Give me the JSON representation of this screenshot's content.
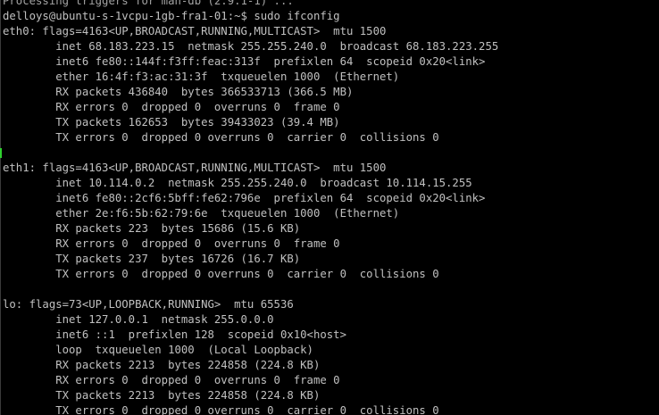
{
  "terminal": {
    "lines": [
      "Processing triggers for man-db (2.9.1-1) ...",
      "delloys@ubuntu-s-1vcpu-1gb-fra1-01:~$ sudo ifconfig",
      "eth0: flags=4163<UP,BROADCAST,RUNNING,MULTICAST>  mtu 1500",
      "        inet 68.183.223.15  netmask 255.255.240.0  broadcast 68.183.223.255",
      "        inet6 fe80::144f:f3ff:feac:313f  prefixlen 64  scopeid 0x20<link>",
      "        ether 16:4f:f3:ac:31:3f  txqueuelen 1000  (Ethernet)",
      "        RX packets 436840  bytes 366533713 (366.5 MB)",
      "        RX errors 0  dropped 0  overruns 0  frame 0",
      "        TX packets 162653  bytes 39433023 (39.4 MB)",
      "        TX errors 0  dropped 0 overruns 0  carrier 0  collisions 0",
      "",
      "eth1: flags=4163<UP,BROADCAST,RUNNING,MULTICAST>  mtu 1500",
      "        inet 10.114.0.2  netmask 255.255.240.0  broadcast 10.114.15.255",
      "        inet6 fe80::2cf6:5bff:fe62:796e  prefixlen 64  scopeid 0x20<link>",
      "        ether 2e:f6:5b:62:79:6e  txqueuelen 1000  (Ethernet)",
      "        RX packets 223  bytes 15686 (15.6 KB)",
      "        RX errors 0  dropped 0  overruns 0  frame 0",
      "        TX packets 237  bytes 16726 (16.7 KB)",
      "        TX errors 0  dropped 0 overruns 0  carrier 0  collisions 0",
      "",
      "lo: flags=73<UP,LOOPBACK,RUNNING>  mtu 65536",
      "        inet 127.0.0.1  netmask 255.0.0.0",
      "        inet6 ::1  prefixlen 128  scopeid 0x10<host>",
      "        loop  txqueuelen 1000  (Local Loopback)",
      "        RX packets 2213  bytes 224858 (224.8 KB)",
      "        RX errors 0  dropped 0  overruns 0  frame 0",
      "        TX packets 2213  bytes 224858 (224.8 KB)",
      "        TX errors 0  dropped 0 overruns 0  carrier 0  collisions 0"
    ]
  },
  "colors": {
    "background": "#000000",
    "text": "#c0c0c0",
    "marker": "#2fd12f"
  }
}
